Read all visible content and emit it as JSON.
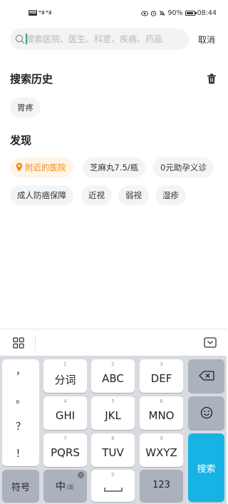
{
  "status_bar": {
    "left_badge": "HD",
    "signal_1": "⁴⁶.ıll",
    "signal_2": "⁴⁶.ıll",
    "battery_pct": "90%",
    "battery_level": 0.9,
    "time": "08:44",
    "icons": [
      "eye-icon",
      "alarm-icon",
      "mute-icon",
      "battery-icon"
    ]
  },
  "search": {
    "placeholder": "搜索医院、医生、科室、疾病、药品",
    "value": "",
    "cancel_label": "取消"
  },
  "history": {
    "title": "搜索历史",
    "items": [
      "胃疼"
    ]
  },
  "discover": {
    "title": "发现",
    "items": [
      "附近的医院",
      "芝麻丸7.5/瓶",
      "0元助孕义诊",
      "成人防癌保障",
      "近视",
      "弱视",
      "湿疹"
    ],
    "highlight_color": "#f08a1c"
  },
  "keyboard": {
    "punctuation": [
      "，",
      "。",
      "？",
      "！"
    ],
    "keys": [
      {
        "num": "1",
        "label": "分词"
      },
      {
        "num": "2",
        "label": "ABC"
      },
      {
        "num": "3",
        "label": "DEF"
      },
      {
        "num": "4",
        "label": "GHI"
      },
      {
        "num": "5",
        "label": "JKL"
      },
      {
        "num": "6",
        "label": "MNO"
      },
      {
        "num": "7",
        "label": "PQRS"
      },
      {
        "num": "8",
        "label": "TUV"
      },
      {
        "num": "9",
        "label": "WXYZ"
      }
    ],
    "symbol_label": "符号",
    "lang_label": "中",
    "lang_sub": "/英",
    "space_num": "0",
    "num_label": "123",
    "search_label": "搜索",
    "accent": "#17b3e5"
  }
}
